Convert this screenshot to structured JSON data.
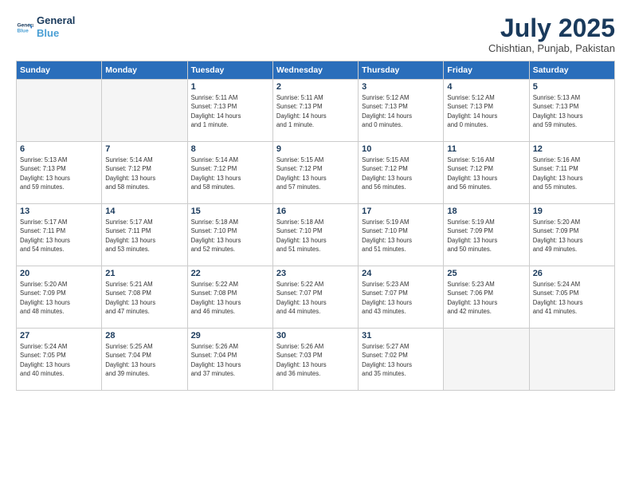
{
  "logo": {
    "line1": "General",
    "line2": "Blue"
  },
  "title": "July 2025",
  "subtitle": "Chishtian, Punjab, Pakistan",
  "days_of_week": [
    "Sunday",
    "Monday",
    "Tuesday",
    "Wednesday",
    "Thursday",
    "Friday",
    "Saturday"
  ],
  "weeks": [
    [
      {
        "day": "",
        "info": ""
      },
      {
        "day": "",
        "info": ""
      },
      {
        "day": "1",
        "info": "Sunrise: 5:11 AM\nSunset: 7:13 PM\nDaylight: 14 hours\nand 1 minute."
      },
      {
        "day": "2",
        "info": "Sunrise: 5:11 AM\nSunset: 7:13 PM\nDaylight: 14 hours\nand 1 minute."
      },
      {
        "day": "3",
        "info": "Sunrise: 5:12 AM\nSunset: 7:13 PM\nDaylight: 14 hours\nand 0 minutes."
      },
      {
        "day": "4",
        "info": "Sunrise: 5:12 AM\nSunset: 7:13 PM\nDaylight: 14 hours\nand 0 minutes."
      },
      {
        "day": "5",
        "info": "Sunrise: 5:13 AM\nSunset: 7:13 PM\nDaylight: 13 hours\nand 59 minutes."
      }
    ],
    [
      {
        "day": "6",
        "info": "Sunrise: 5:13 AM\nSunset: 7:13 PM\nDaylight: 13 hours\nand 59 minutes."
      },
      {
        "day": "7",
        "info": "Sunrise: 5:14 AM\nSunset: 7:12 PM\nDaylight: 13 hours\nand 58 minutes."
      },
      {
        "day": "8",
        "info": "Sunrise: 5:14 AM\nSunset: 7:12 PM\nDaylight: 13 hours\nand 58 minutes."
      },
      {
        "day": "9",
        "info": "Sunrise: 5:15 AM\nSunset: 7:12 PM\nDaylight: 13 hours\nand 57 minutes."
      },
      {
        "day": "10",
        "info": "Sunrise: 5:15 AM\nSunset: 7:12 PM\nDaylight: 13 hours\nand 56 minutes."
      },
      {
        "day": "11",
        "info": "Sunrise: 5:16 AM\nSunset: 7:12 PM\nDaylight: 13 hours\nand 56 minutes."
      },
      {
        "day": "12",
        "info": "Sunrise: 5:16 AM\nSunset: 7:11 PM\nDaylight: 13 hours\nand 55 minutes."
      }
    ],
    [
      {
        "day": "13",
        "info": "Sunrise: 5:17 AM\nSunset: 7:11 PM\nDaylight: 13 hours\nand 54 minutes."
      },
      {
        "day": "14",
        "info": "Sunrise: 5:17 AM\nSunset: 7:11 PM\nDaylight: 13 hours\nand 53 minutes."
      },
      {
        "day": "15",
        "info": "Sunrise: 5:18 AM\nSunset: 7:10 PM\nDaylight: 13 hours\nand 52 minutes."
      },
      {
        "day": "16",
        "info": "Sunrise: 5:18 AM\nSunset: 7:10 PM\nDaylight: 13 hours\nand 51 minutes."
      },
      {
        "day": "17",
        "info": "Sunrise: 5:19 AM\nSunset: 7:10 PM\nDaylight: 13 hours\nand 51 minutes."
      },
      {
        "day": "18",
        "info": "Sunrise: 5:19 AM\nSunset: 7:09 PM\nDaylight: 13 hours\nand 50 minutes."
      },
      {
        "day": "19",
        "info": "Sunrise: 5:20 AM\nSunset: 7:09 PM\nDaylight: 13 hours\nand 49 minutes."
      }
    ],
    [
      {
        "day": "20",
        "info": "Sunrise: 5:20 AM\nSunset: 7:09 PM\nDaylight: 13 hours\nand 48 minutes."
      },
      {
        "day": "21",
        "info": "Sunrise: 5:21 AM\nSunset: 7:08 PM\nDaylight: 13 hours\nand 47 minutes."
      },
      {
        "day": "22",
        "info": "Sunrise: 5:22 AM\nSunset: 7:08 PM\nDaylight: 13 hours\nand 46 minutes."
      },
      {
        "day": "23",
        "info": "Sunrise: 5:22 AM\nSunset: 7:07 PM\nDaylight: 13 hours\nand 44 minutes."
      },
      {
        "day": "24",
        "info": "Sunrise: 5:23 AM\nSunset: 7:07 PM\nDaylight: 13 hours\nand 43 minutes."
      },
      {
        "day": "25",
        "info": "Sunrise: 5:23 AM\nSunset: 7:06 PM\nDaylight: 13 hours\nand 42 minutes."
      },
      {
        "day": "26",
        "info": "Sunrise: 5:24 AM\nSunset: 7:05 PM\nDaylight: 13 hours\nand 41 minutes."
      }
    ],
    [
      {
        "day": "27",
        "info": "Sunrise: 5:24 AM\nSunset: 7:05 PM\nDaylight: 13 hours\nand 40 minutes."
      },
      {
        "day": "28",
        "info": "Sunrise: 5:25 AM\nSunset: 7:04 PM\nDaylight: 13 hours\nand 39 minutes."
      },
      {
        "day": "29",
        "info": "Sunrise: 5:26 AM\nSunset: 7:04 PM\nDaylight: 13 hours\nand 37 minutes."
      },
      {
        "day": "30",
        "info": "Sunrise: 5:26 AM\nSunset: 7:03 PM\nDaylight: 13 hours\nand 36 minutes."
      },
      {
        "day": "31",
        "info": "Sunrise: 5:27 AM\nSunset: 7:02 PM\nDaylight: 13 hours\nand 35 minutes."
      },
      {
        "day": "",
        "info": ""
      },
      {
        "day": "",
        "info": ""
      }
    ]
  ]
}
